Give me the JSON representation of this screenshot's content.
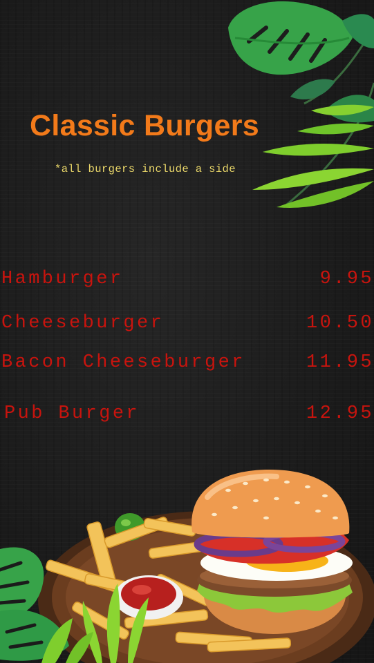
{
  "menu": {
    "title": "Classic Burgers",
    "subtitle": "*all burgers include a side",
    "items": [
      {
        "name": "Hamburger",
        "price": "9.95"
      },
      {
        "name": "Cheeseburger",
        "price": "10.50"
      },
      {
        "name": "Bacon Cheeseburger",
        "price": "11.95"
      },
      {
        "name": "Pub Burger",
        "price": "12.95"
      }
    ]
  },
  "colors": {
    "background": "#1c1c1c",
    "title": "#f27a1a",
    "subtitle": "#ecd96a",
    "item_text": "#c8140e",
    "leaf_dark": "#2f9a46",
    "leaf_light": "#7ccf2c"
  },
  "illustrations": {
    "top_right": "tropical-leaves-icon",
    "bottom": "burger-and-fries-plate-illustration",
    "bottom_left": "monstera-leaf-icon"
  }
}
